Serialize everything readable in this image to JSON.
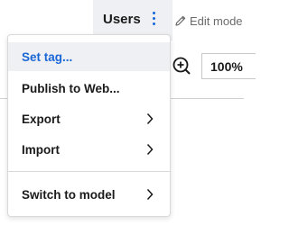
{
  "header": {
    "active_tab_label": "Users",
    "edit_mode_label": "Edit mode"
  },
  "toolbar": {
    "zoom_value": "100%"
  },
  "menu": {
    "items": [
      {
        "label": "Set tag...",
        "has_submenu": false
      },
      {
        "label": "Publish to Web...",
        "has_submenu": false
      },
      {
        "label": "Export",
        "has_submenu": true
      },
      {
        "label": "Import",
        "has_submenu": true
      },
      {
        "label": "Switch to model",
        "has_submenu": true
      }
    ]
  },
  "colors": {
    "accent": "#1b67d6",
    "highlight_bg": "#eef0f3"
  },
  "icons": [
    "kebab-menu-icon",
    "pencil-icon",
    "zoom-in-icon",
    "chevron-right-icon"
  ]
}
